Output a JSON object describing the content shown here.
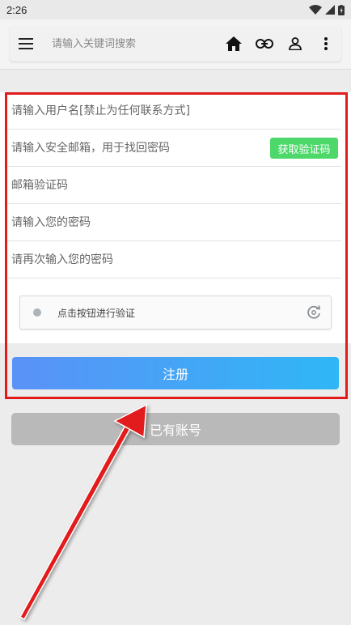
{
  "status_bar": {
    "time": "2:26"
  },
  "topbar": {
    "search_placeholder": "请输入关键词搜索"
  },
  "form": {
    "username_placeholder": "请输入用户名[禁止为任何联系方式]",
    "email_placeholder": "请输入安全邮箱，用于找回密码",
    "get_code_label": "获取验证码",
    "email_code_placeholder": "邮箱验证码",
    "password_placeholder": "请输入您的密码",
    "confirm_password_placeholder": "请再次输入您的密码",
    "captcha_label": "点击按钮进行验证",
    "register_label": "注册",
    "login_label": "已有账号"
  },
  "colors": {
    "annotation": "#e21b1b",
    "register_start": "#5a92f7",
    "register_end": "#2fb7f6",
    "code_button": "#4cd96a",
    "login_button": "#b9b9b9"
  }
}
